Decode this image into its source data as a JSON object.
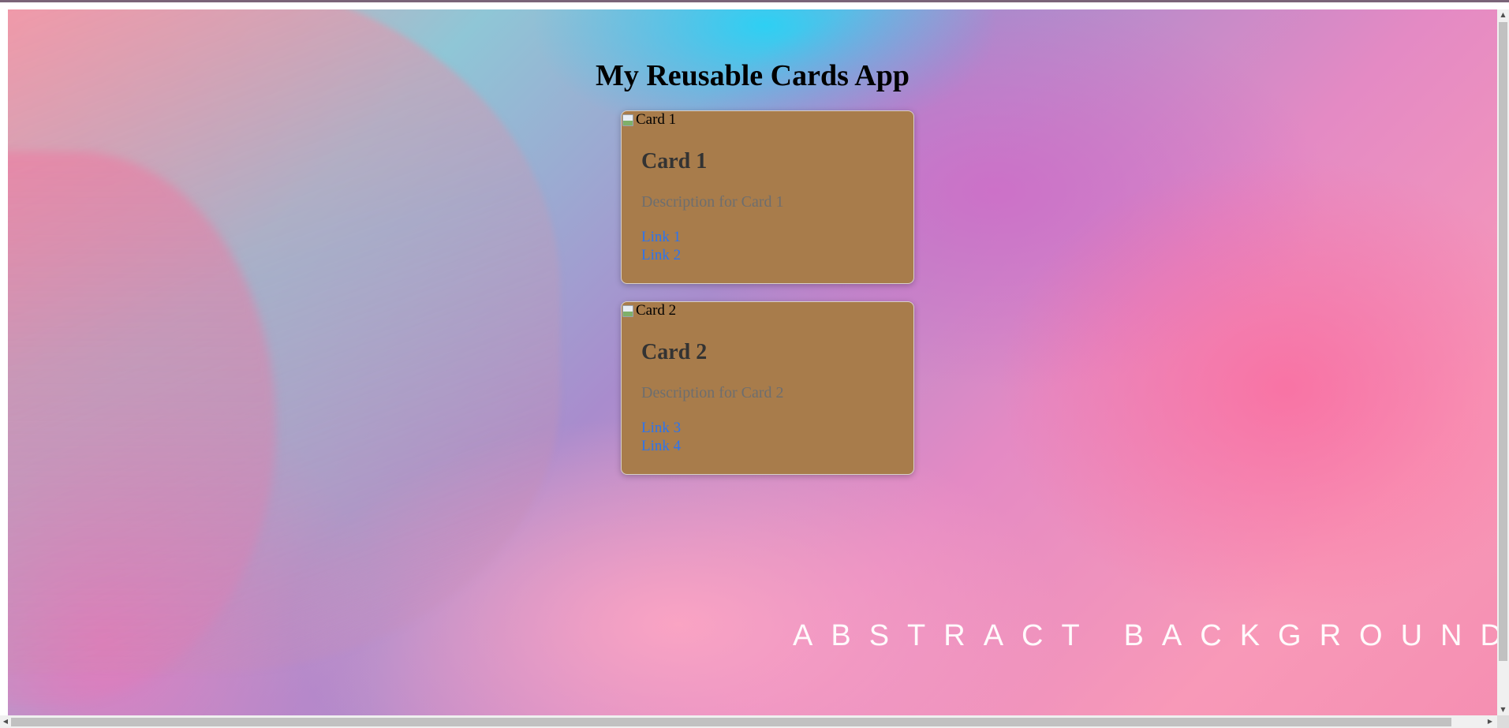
{
  "page": {
    "title": "My Reusable Cards App",
    "background_caption": "ABSTRACT BACKGROUND"
  },
  "cards": [
    {
      "image_alt": "Card 1",
      "title": "Card 1",
      "description": "Description for Card 1",
      "links": [
        "Link 1",
        "Link 2"
      ]
    },
    {
      "image_alt": "Card 2",
      "title": "Card 2",
      "description": "Description for Card 2",
      "links": [
        "Link 3",
        "Link 4"
      ]
    }
  ],
  "colors": {
    "card_background": "#a87c4b",
    "card_title": "#333333",
    "card_description": "#6e6e6e",
    "link": "#2b74f0"
  },
  "icons": {
    "broken_image": "broken-image-icon",
    "scroll_up": "▲",
    "scroll_down": "▼",
    "scroll_left": "◀",
    "scroll_right": "▶"
  }
}
